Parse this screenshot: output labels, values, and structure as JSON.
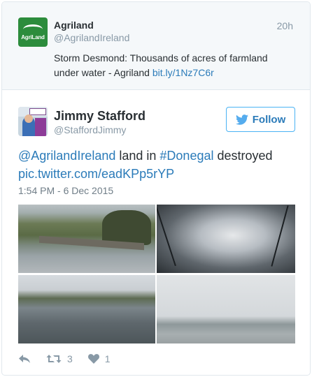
{
  "parent_tweet": {
    "avatar_text": "AgriLand",
    "name": "Agriland",
    "handle": "@AgrilandIreland",
    "time": "20h",
    "text": "Storm Desmond: Thousands of acres of farmland under water - Agriland ",
    "link": "bit.ly/1Nz7C6r"
  },
  "tweet": {
    "name": "Jimmy Stafford",
    "handle": "@StaffordJimmy",
    "follow_label": "Follow",
    "mention": "@AgrilandIreland",
    "text_mid": " land in ",
    "hashtag": "#Donegal",
    "text_end": " destroyed",
    "pic_link": "pic.twitter.com/eadKPp5rYP",
    "date": "1:54 PM - 6 Dec 2015"
  },
  "actions": {
    "retweet_count": "3",
    "like_count": "1"
  },
  "colors": {
    "link": "#2b7bb9",
    "muted": "#8899a6",
    "follow_border": "#4ab3f4",
    "agriland_green": "#2c8c3c"
  }
}
